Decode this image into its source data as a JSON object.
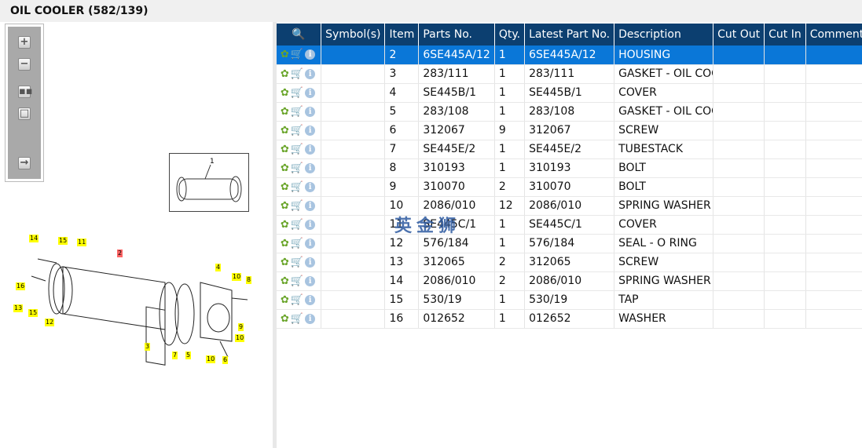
{
  "title": "OIL COOLER (582/139)",
  "toolbox": {
    "icons": [
      "zoom-in",
      "zoom-out",
      "fit-all",
      "fit-page",
      "export"
    ]
  },
  "thumbnail": {
    "callout": "1"
  },
  "diagram": {
    "callouts": [
      "14",
      "15",
      "11",
      "2",
      "4",
      "10",
      "8",
      "16",
      "13",
      "15",
      "12",
      "9",
      "10",
      "3",
      "7",
      "5",
      "10",
      "6"
    ]
  },
  "watermark": "英金狮",
  "table": {
    "columns": [
      "Symbol(s)",
      "Item",
      "Parts No.",
      "Qty.",
      "Latest Part No.",
      "Description",
      "Cut Out",
      "Cut In",
      "Comment"
    ],
    "rows": [
      {
        "item": "2",
        "part": "6SE445A/12",
        "qty": "1",
        "latest": "6SE445A/12",
        "desc": "HOUSING",
        "selected": true
      },
      {
        "item": "3",
        "part": "283/111",
        "qty": "1",
        "latest": "283/111",
        "desc": "GASKET - OIL COC"
      },
      {
        "item": "4",
        "part": "SE445B/1",
        "qty": "1",
        "latest": "SE445B/1",
        "desc": "COVER"
      },
      {
        "item": "5",
        "part": "283/108",
        "qty": "1",
        "latest": "283/108",
        "desc": "GASKET - OIL COC"
      },
      {
        "item": "6",
        "part": "312067",
        "qty": "9",
        "latest": "312067",
        "desc": "SCREW"
      },
      {
        "item": "7",
        "part": "SE445E/2",
        "qty": "1",
        "latest": "SE445E/2",
        "desc": "TUBESTACK"
      },
      {
        "item": "8",
        "part": "310193",
        "qty": "1",
        "latest": "310193",
        "desc": "BOLT"
      },
      {
        "item": "9",
        "part": "310070",
        "qty": "2",
        "latest": "310070",
        "desc": "BOLT"
      },
      {
        "item": "10",
        "part": "2086/010",
        "qty": "12",
        "latest": "2086/010",
        "desc": "SPRING WASHER"
      },
      {
        "item": "11",
        "part": "SE445C/1",
        "qty": "1",
        "latest": "SE445C/1",
        "desc": "COVER"
      },
      {
        "item": "12",
        "part": "576/184",
        "qty": "1",
        "latest": "576/184",
        "desc": "SEAL - O RING"
      },
      {
        "item": "13",
        "part": "312065",
        "qty": "2",
        "latest": "312065",
        "desc": "SCREW"
      },
      {
        "item": "14",
        "part": "2086/010",
        "qty": "2",
        "latest": "2086/010",
        "desc": "SPRING WASHER"
      },
      {
        "item": "15",
        "part": "530/19",
        "qty": "1",
        "latest": "530/19",
        "desc": "TAP"
      },
      {
        "item": "16",
        "part": "012652",
        "qty": "1",
        "latest": "012652",
        "desc": "WASHER"
      }
    ]
  }
}
